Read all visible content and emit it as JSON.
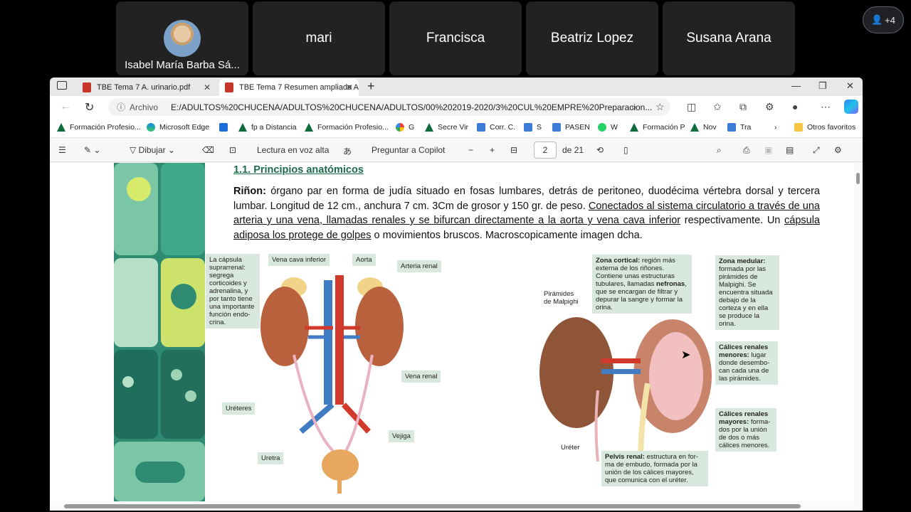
{
  "meeting": {
    "participants": [
      {
        "name": "Isabel María Barba Sá..."
      },
      {
        "name": "mari"
      },
      {
        "name": "Francisca"
      },
      {
        "name": "Beatriz Lopez"
      },
      {
        "name": "Susana Arana"
      }
    ],
    "more_count": "+4"
  },
  "browser": {
    "tabs": [
      {
        "title": "TBE Tema 7 A. urinario.pdf"
      },
      {
        "title": "TBE Tema 7 Resumen ampliado A"
      }
    ],
    "address": {
      "scheme_label": "Archivo",
      "url": "E:/ADULTOS%20CHUCENA/ADULTOS%20CHUCENA/ADULTOS/00%202019-2020/3%20CUL%20EMPRE%20Preparacion..."
    },
    "favorites": [
      {
        "label": "Formación Profesio...",
        "icon": "a"
      },
      {
        "label": "Microsoft Edge",
        "icon": "edge"
      },
      {
        "label": "",
        "icon": "b"
      },
      {
        "label": "fp a Distancia",
        "icon": "a"
      },
      {
        "label": "Formación Profesio...",
        "icon": "a"
      },
      {
        "label": "G",
        "icon": "g"
      },
      {
        "label": "Secre Vir",
        "icon": "a"
      },
      {
        "label": "Corr. C.",
        "icon": "misc"
      },
      {
        "label": "S",
        "icon": "misc"
      },
      {
        "label": "PASEN",
        "icon": "misc"
      },
      {
        "label": "W",
        "icon": "w"
      },
      {
        "label": "Formación P",
        "icon": "a"
      },
      {
        "label": "Nov",
        "icon": "a"
      },
      {
        "label": "Tra",
        "icon": "misc"
      }
    ],
    "other_favorites": "Otros favoritos"
  },
  "pdf_toolbar": {
    "draw_label": "Dibujar",
    "read_aloud_label": "Lectura en voz alta",
    "copilot_label": "Preguntar a Copilot",
    "page_current": "2",
    "page_total": "de 21"
  },
  "document": {
    "heading": "1.1. Principios anatómicos",
    "para_term": "Riñon:",
    "para_1": " órgano par en forma de judía situado en fosas lumbares, detrás de peritoneo, duodécima vértebra dorsal y tercera lumbar. Longitud de 12 cm., anchura 7 cm. 3Cm de grosor y 150 gr. de peso. ",
    "para_u1": "Conectados al sistema circulatorio a través de una arteria y una vena, llamadas renales y se bifurcan directamente a la aorta y vena cava inferior",
    "para_2": " respectivamente. Un ",
    "para_u2": "cápsula adiposa los protege de golpes",
    "para_3": " o movimientos bruscos. Macroscopicamente  imagen dcha.",
    "left_labels": {
      "capsula": "La cápsula suprarrenal: segrega corticoides y adrenalina, y por tanto tiene una importante función endo-crina.",
      "vena_cava": "Vena cava inferior",
      "aorta": "Aorta",
      "arteria_renal": "Arteria renal",
      "vena_renal": "Vena renal",
      "ureteres": "Uréteres",
      "vejiga": "Vejiga",
      "uretra": "Uretra"
    },
    "right_labels": {
      "cortical_title": "Zona cortical:",
      "cortical_text": " región más externa de los riñones. Contiene unas estructuras tubulares, llamadas ",
      "cortical_bold": "nefronas",
      "cortical_end": ", que se encargan de filtrar y depurar la sangre y formar la orina.",
      "piramides": "Pirámides de Malpighi",
      "medular_title": "Zona medular:",
      "medular_text": " formada por las pirámides de Malpighi. Se encuentra situada debajo de la corteza y en ella se produce la orina.",
      "menores_title": "Cálices renales menores:",
      "menores_text": " lugar donde desembo-can cada una de las pirámides.",
      "mayores_title": "Cálices renales mayores:",
      "mayores_text": " forma-dos por la unión de dos o más cálices menores.",
      "pelvis_title": "Pelvis renal:",
      "pelvis_text": " estructura en for-ma de embudo, formada por la unión de los cálices mayores, que comunica con el uréter.",
      "ureter": "Uréter"
    }
  },
  "colors": {
    "heading_green": "#1c6b49",
    "label_bg": "#d9e8de",
    "deco_green": "#2f8a72"
  }
}
